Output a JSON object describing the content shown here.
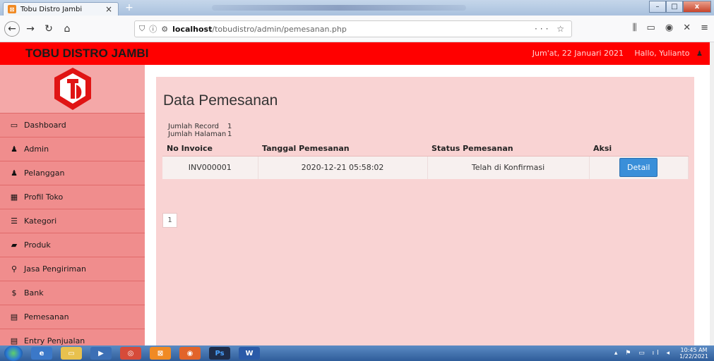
{
  "browser": {
    "tab_title": "Tobu Distro Jambi",
    "tab_close": "×",
    "new_tab": "+",
    "url_host": "localhost",
    "url_path": "/tobudistro/admin/pemesanan.php",
    "url_prefix": "localhost/tobudistro/admin/pemesanan.php",
    "url_actions": "··· ☆",
    "win_min": "–",
    "win_max": "□",
    "win_close": "x"
  },
  "header": {
    "brand": "TOBU DISTRO JAMBI",
    "date": "Jum'at, 22 Januari 2021",
    "user": "Hallo, Yulianto"
  },
  "sidebar": {
    "items": [
      {
        "label": "Dashboard",
        "icon": "▭"
      },
      {
        "label": "Admin",
        "icon": "♟"
      },
      {
        "label": "Pelanggan",
        "icon": "♟"
      },
      {
        "label": "Profil Toko",
        "icon": "▦"
      },
      {
        "label": "Kategori",
        "icon": "☰"
      },
      {
        "label": "Produk",
        "icon": "▰"
      },
      {
        "label": "Jasa Pengiriman",
        "icon": "⚲"
      },
      {
        "label": "Bank",
        "icon": "$"
      },
      {
        "label": "Pemesanan",
        "icon": "▤"
      },
      {
        "label": "Entry Penjualan",
        "icon": "▤"
      }
    ]
  },
  "main": {
    "title": "Data Pemesanan",
    "jumlah_record_label": "Jumlah Record",
    "jumlah_record_value": "1",
    "jumlah_halaman_label": "Jumlah Halaman",
    "jumlah_halaman_value": "1",
    "table": {
      "headers": [
        "No Invoice",
        "Tanggal Pemesanan",
        "Status Pemesanan",
        "Aksi"
      ],
      "rows": [
        {
          "invoice": "INV000001",
          "tanggal": "2020-12-21 05:58:02",
          "status": "Telah di Konfirmasi",
          "aksi": "Detail"
        }
      ]
    },
    "pagination": [
      "1"
    ]
  },
  "taskbar": {
    "time": "10:45 AM",
    "date": "1/22/2021",
    "ps_label": "Ps"
  }
}
